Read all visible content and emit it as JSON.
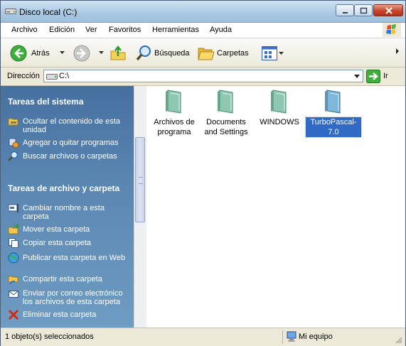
{
  "window": {
    "title": "Disco local (C:)"
  },
  "menu": [
    "Archivo",
    "Edición",
    "Ver",
    "Favoritos",
    "Herramientas",
    "Ayuda"
  ],
  "toolbar": {
    "back_label": "Atrás",
    "search_label": "Búsqueda",
    "folders_label": "Carpetas"
  },
  "address": {
    "label": "Dirección",
    "value": "C:\\",
    "go_label": "Ir"
  },
  "system_tasks": {
    "title": "Tareas del sistema",
    "items": [
      {
        "label": "Ocultar el contenido de esta unidad",
        "icon": "hide-contents-icon"
      },
      {
        "label": "Agregar o quitar programas",
        "icon": "add-remove-programs-icon"
      },
      {
        "label": "Buscar archivos o carpetas",
        "icon": "search-icon"
      }
    ]
  },
  "file_tasks": {
    "title": "Tareas de archivo y carpeta",
    "items": [
      {
        "label": "Cambiar nombre a esta carpeta",
        "icon": "rename-icon"
      },
      {
        "label": "Mover esta carpeta",
        "icon": "move-icon"
      },
      {
        "label": "Copiar esta carpeta",
        "icon": "copy-icon"
      },
      {
        "label": "Publicar esta carpeta en Web",
        "icon": "publish-web-icon"
      },
      {
        "label": "Compartir esta carpeta",
        "icon": "share-icon"
      },
      {
        "label": "Enviar por correo electrónico los archivos de esta carpeta",
        "icon": "email-icon"
      },
      {
        "label": "Eliminar esta carpeta",
        "icon": "delete-icon"
      }
    ]
  },
  "folders": [
    {
      "name": "Archivos de programa",
      "selected": false
    },
    {
      "name": "Documents and Settings",
      "selected": false
    },
    {
      "name": "WINDOWS",
      "selected": false
    },
    {
      "name": "TurboPascal-7.0",
      "selected": true
    }
  ],
  "status": {
    "selection": "1 objeto(s) seleccionados",
    "location": "Mi equipo"
  }
}
